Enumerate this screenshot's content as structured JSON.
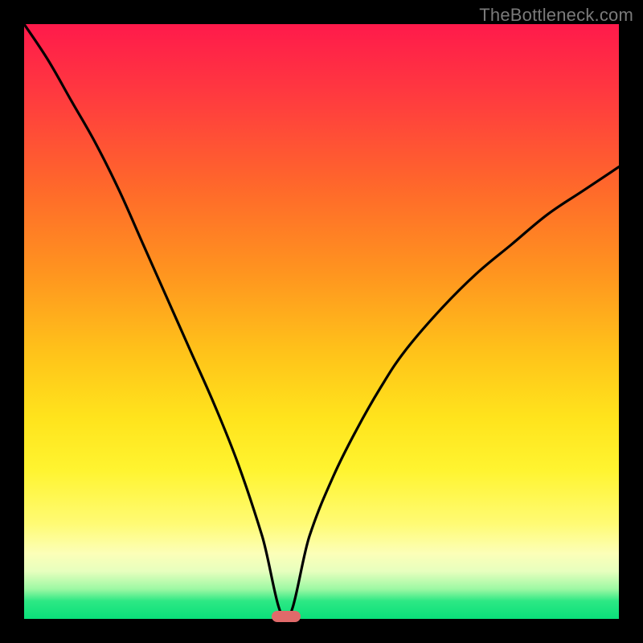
{
  "watermark": "TheBottleneck.com",
  "colors": {
    "frame": "#000000",
    "curve_stroke": "#000000",
    "minmarker": "#e06a6a"
  },
  "chart_data": {
    "type": "line",
    "title": "",
    "xlabel": "",
    "ylabel": "",
    "xlim": [
      0,
      100
    ],
    "ylim": [
      0,
      100
    ],
    "grid": false,
    "legend": false,
    "annotations": [
      {
        "what": "min-marker",
        "x": 44,
        "y": 0
      }
    ],
    "series": [
      {
        "name": "bottleneck-curve",
        "x": [
          0,
          4,
          8,
          12,
          16,
          20,
          24,
          28,
          32,
          36,
          40,
          44,
          48,
          52,
          56,
          60,
          64,
          70,
          76,
          82,
          88,
          94,
          100
        ],
        "y": [
          100,
          94,
          87,
          80,
          72,
          63,
          54,
          45,
          36,
          26,
          14,
          0,
          14,
          24,
          32,
          39,
          45,
          52,
          58,
          63,
          68,
          72,
          76
        ]
      }
    ],
    "background_gradient_stops": [
      {
        "pos": 0,
        "color": "#ff1a4b"
      },
      {
        "pos": 12,
        "color": "#ff3a3f"
      },
      {
        "pos": 28,
        "color": "#ff6a2a"
      },
      {
        "pos": 42,
        "color": "#ff951f"
      },
      {
        "pos": 55,
        "color": "#ffc21a"
      },
      {
        "pos": 66,
        "color": "#ffe31c"
      },
      {
        "pos": 75,
        "color": "#fff430"
      },
      {
        "pos": 84,
        "color": "#fffb74"
      },
      {
        "pos": 89,
        "color": "#fcffb8"
      },
      {
        "pos": 92,
        "color": "#e7ffbe"
      },
      {
        "pos": 95,
        "color": "#9cf8a3"
      },
      {
        "pos": 97,
        "color": "#2de884"
      },
      {
        "pos": 100,
        "color": "#0adf7a"
      }
    ]
  }
}
